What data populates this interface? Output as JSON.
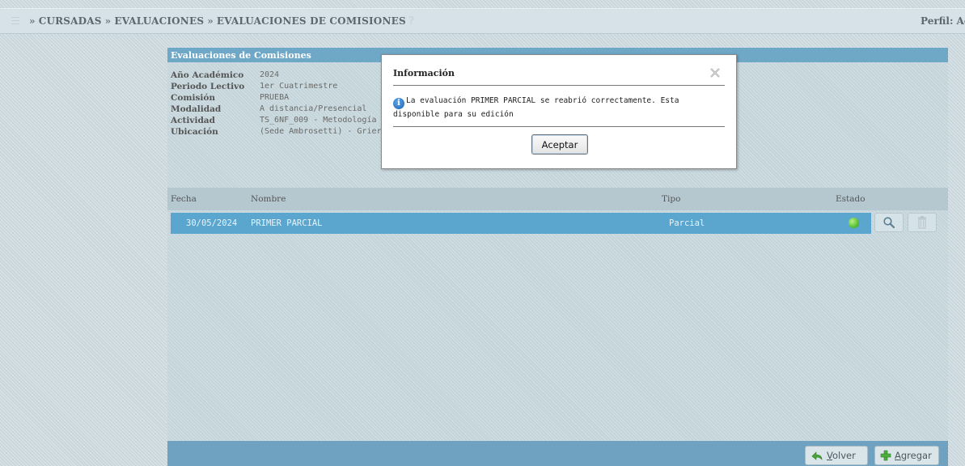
{
  "breadcrumb": {
    "items": [
      "CURSADAS",
      "EVALUACIONES",
      "EVALUACIONES DE COMISIONES"
    ],
    "separator": "»",
    "help": "?"
  },
  "perfil_label": "Perfil: Ac",
  "panel": {
    "title": "Evaluaciones de Comisiones",
    "info": [
      {
        "label": "Año Académico",
        "value": "2024"
      },
      {
        "label": "Periodo Lectivo",
        "value": "1er Cuatrimestre"
      },
      {
        "label": "Comisión",
        "value": "PRUEBA"
      },
      {
        "label": "Modalidad",
        "value": "A distancia/Presencial"
      },
      {
        "label": "Actividad",
        "value": "TS_6NF_009 - Metodología d"
      },
      {
        "label": "Ubicación",
        "value": "(Sede Ambrosetti) - Grierso"
      }
    ],
    "grid": {
      "columns": [
        "Fecha",
        "Nombre",
        "Tipo",
        "Estado"
      ],
      "rows": [
        {
          "fecha": "30/05/2024",
          "nombre": "PRIMER PARCIAL",
          "tipo": "Parcial",
          "estado_color": "#5cc232"
        }
      ]
    },
    "footer": {
      "volver": {
        "underlined": "V",
        "rest": "olver"
      },
      "agregar": {
        "underlined": "A",
        "rest": "gregar"
      }
    }
  },
  "dialog": {
    "title": "Información",
    "message": "La evaluación PRIMER PARCIAL se reabrió correctamente. Esta disponible para su edición",
    "accept_label": "Aceptar"
  },
  "colors": {
    "header_blue": "#6fa7c7",
    "row_selected": "#5aa6cf",
    "status_green": "#5cc232"
  }
}
